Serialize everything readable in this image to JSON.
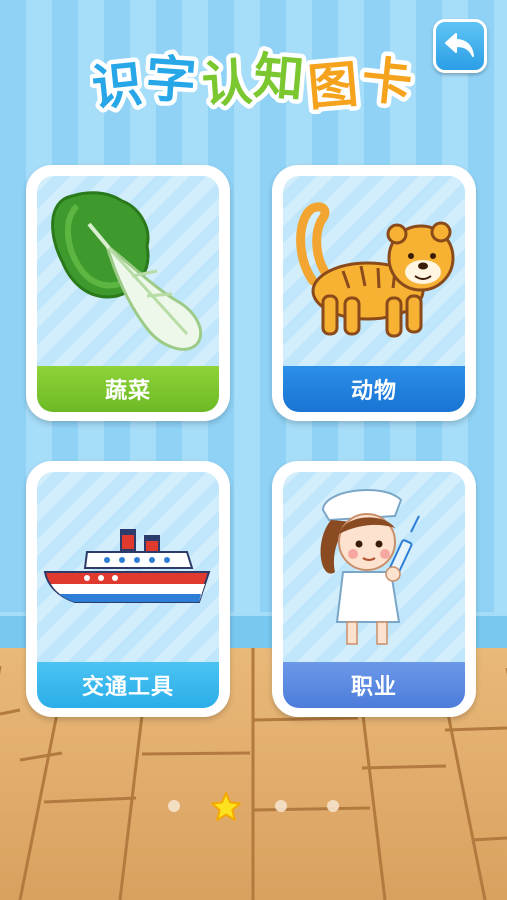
{
  "app": {
    "title": "识字认知图卡",
    "title_chars": [
      "识",
      "字",
      "认",
      "知",
      "图",
      "卡"
    ]
  },
  "cards": [
    {
      "label": "蔬菜",
      "icon": "vegetable-icon",
      "color": "#7cc82e"
    },
    {
      "label": "动物",
      "icon": "tiger-icon",
      "color": "#2283df"
    },
    {
      "label": "交通工具",
      "icon": "ship-icon",
      "color": "#39b8ee"
    },
    {
      "label": "职业",
      "icon": "nurse-icon",
      "color": "#5d8ae1"
    }
  ],
  "pagination": {
    "total": 4,
    "current": 2
  },
  "colors": {
    "wall": "#9ad7f7",
    "floor": "#e0ac6b",
    "back_button": "#3aa9ec"
  }
}
